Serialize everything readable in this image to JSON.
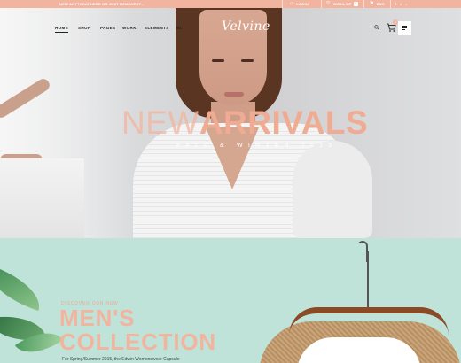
{
  "topbar": {
    "promo": "NEW ANYTHING HERE OR JUST REMOVE IT...",
    "login_label": "LOGIN",
    "wishlist_label": "WISHLIST",
    "wishlist_count": "0",
    "language_label": "ENG",
    "social_icons": [
      "facebook-icon",
      "twitter-icon",
      "instagram-icon"
    ]
  },
  "nav": {
    "items": [
      "HOME",
      "SHOP",
      "PAGES",
      "WORK",
      "ELEMENTS",
      "BL"
    ],
    "active": "HOME"
  },
  "brand": {
    "logo": "Velvine"
  },
  "header_icons": {
    "search": "search-icon",
    "cart": "cart-icon",
    "cart_count": "0",
    "menu": "menu-icon"
  },
  "hero": {
    "title_thin": "NEW",
    "title_bold": "ARRIVALS",
    "subtitle": "FALL & WINTER 2015"
  },
  "collection": {
    "eyebrow": "DISCOVER OUR NEW",
    "title_line1": "MEN'S",
    "title_line2": "COLLECTION",
    "description": "For Spring/Summer 2015, the Edwin Womenswear Capsule"
  },
  "colors": {
    "accent": "#f2b49f",
    "mint": "#bfe3d9",
    "text_dark": "#222222"
  }
}
